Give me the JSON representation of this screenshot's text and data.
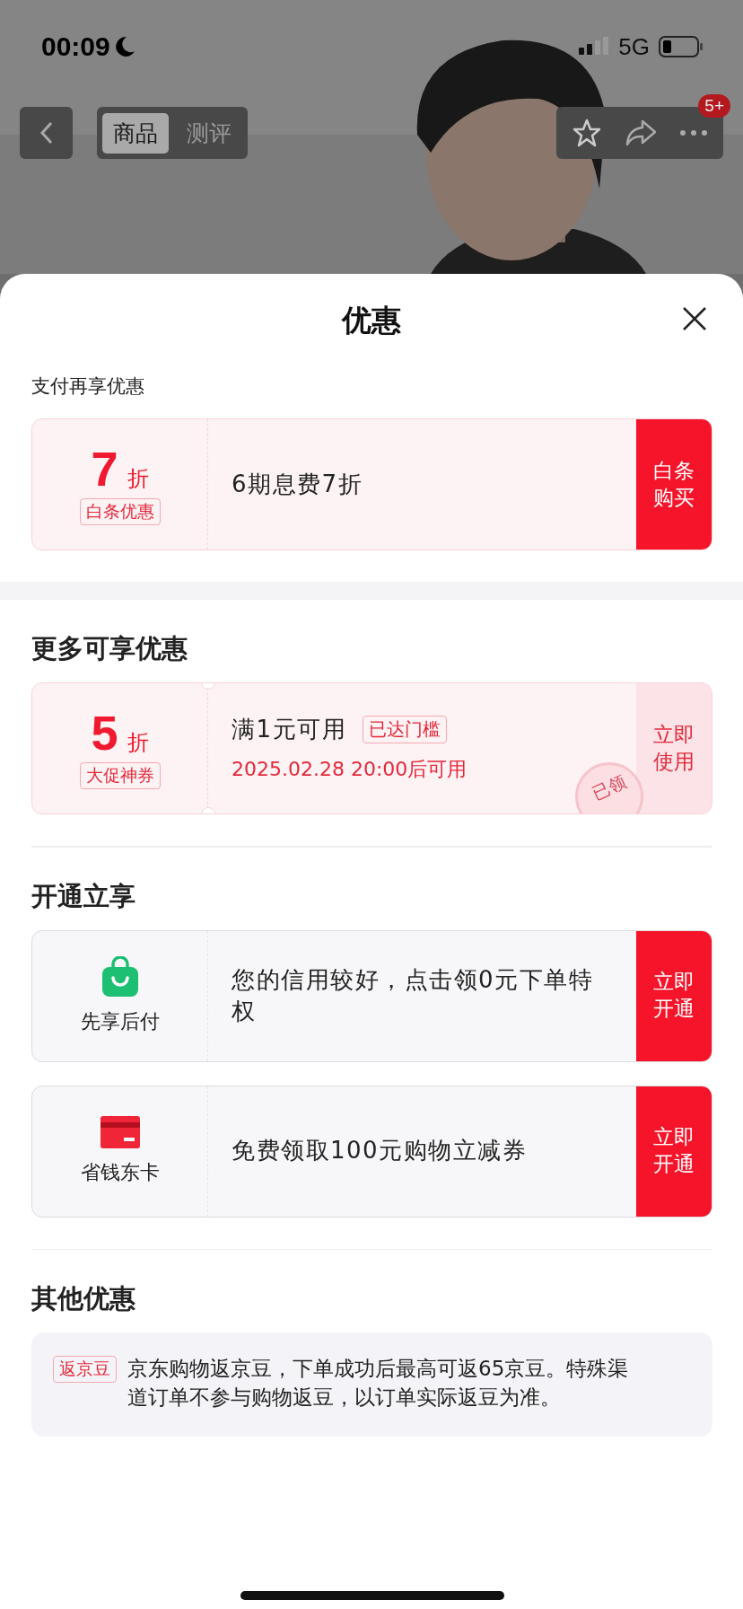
{
  "status_bar": {
    "time": "00:09",
    "network": "5G"
  },
  "nav": {
    "tabs": [
      {
        "label": "商品",
        "selected": true
      },
      {
        "label": "测评",
        "selected": false
      }
    ],
    "badge": "5+"
  },
  "sheet": {
    "title": "优惠",
    "sections": [
      {
        "kind": "subtitle",
        "heading": "支付再享优惠",
        "offers": [
          {
            "kind": "discount",
            "value": "7",
            "unit": "折",
            "tag": "白条优惠",
            "text": "6期息费7折",
            "action": "白条购买",
            "filled": true
          }
        ]
      },
      {
        "kind": "heading",
        "heading": "更多可享优惠",
        "offers": [
          {
            "kind": "discount",
            "value": "5",
            "unit": "折",
            "tag": "大促神券",
            "text": "满1元可用",
            "badge": "已达门槛",
            "note": "2025.02.28 20:00后可用",
            "stamp": "已领",
            "action": "立即使用",
            "filled": false
          }
        ]
      },
      {
        "kind": "heading",
        "heading": "开通立享",
        "offers": [
          {
            "kind": "service",
            "name": "先享后付",
            "text": "您的信用较好，点击领0元下单特权",
            "action": "立即开通",
            "filled": true
          },
          {
            "kind": "service",
            "name": "省钱东卡",
            "text": "免费领取100元购物立减券",
            "action": "立即开通",
            "filled": true
          }
        ]
      },
      {
        "kind": "heading",
        "heading": "其他优惠",
        "offers": [
          {
            "kind": "info",
            "tag": "返京豆",
            "text": "京东购物返京豆，下单成功后最高可返65京豆。特殊渠道订单不参与购物返豆，以订单实际返豆为准。"
          }
        ]
      }
    ]
  }
}
